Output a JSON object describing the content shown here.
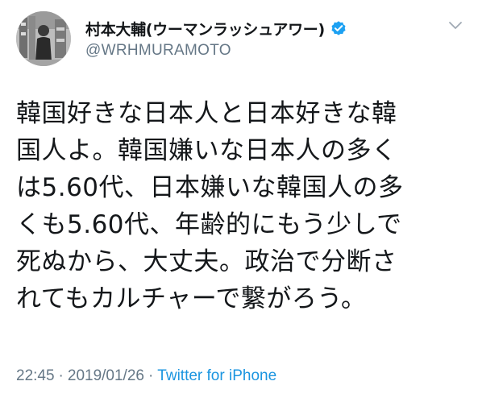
{
  "author": {
    "display_name": "村本大輔(ウーマンラッシュアワー)",
    "handle": "@WRHMURAMOTO",
    "verified": true
  },
  "tweet": {
    "lines": [
      "韓国好きな日本人と日本好きな韓",
      "国人よ。韓国嫌いな日本人の多く",
      "は5.60代、日本嫌いな韓国人の多",
      "くも5.60代、年齢的にもう少しで",
      "死ぬから、大丈夫。政治で分断さ",
      "れてもカルチャーで繋がろう。"
    ]
  },
  "meta": {
    "time": "22:45",
    "separator": "·",
    "date": "2019/01/26",
    "source": "Twitter for iPhone"
  },
  "colors": {
    "text": "#14171a",
    "secondary": "#657786",
    "link": "#1b95e0",
    "verified": "#1da1f2"
  },
  "icons": {
    "verified": "verified-badge-icon",
    "menu": "chevron-down-icon"
  }
}
